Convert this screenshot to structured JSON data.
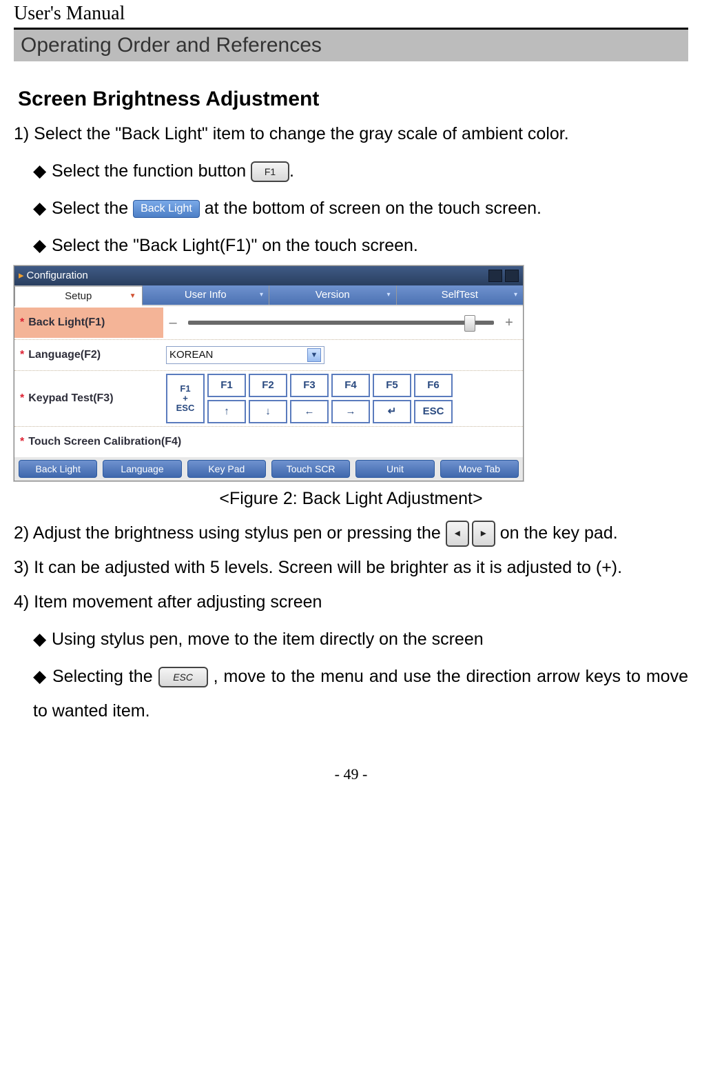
{
  "header": {
    "manual_title": "User's Manual",
    "section_bar": "Operating Order and References"
  },
  "subsection_title": "Screen Brightness Adjustment",
  "steps": {
    "s1": "1) Select the \"Back Light\" item to change the gray scale of ambient color.",
    "s1_b1_a": "Select the function button ",
    "s1_b1_icon": "F1",
    "s1_b1_b": ".",
    "s1_b2_a": "Select the ",
    "s1_b2_btn": "Back Light",
    "s1_b2_b": " at the bottom of screen on the touch screen.",
    "s1_b3": "Select the \"Back Light(F1)\" on the touch screen.",
    "s2_a": "2) Adjust the brightness using stylus pen or pressing the ",
    "s2_b": " on the key pad.",
    "s3": "3) It can be adjusted with 5 levels. Screen will be brighter as it is adjusted to (+).",
    "s4": "4) Item movement after adjusting screen",
    "s4_b1": "Using stylus pen, move to the item directly on the screen",
    "s4_b2_a": "Selecting the ",
    "s4_b2_icon": "ESC",
    "s4_b2_b": ", move to the menu and use the direction arrow keys to move to wanted item."
  },
  "figure": {
    "title": "Configuration",
    "tabs": [
      "Setup",
      "User Info",
      "Version",
      "SelfTest"
    ],
    "rows": {
      "r1": "Back Light(F1)",
      "r2": "Language(F2)",
      "r2_value": "KOREAN",
      "r3": "Keypad Test(F3)",
      "r4": "Touch Screen Calibration(F4)"
    },
    "keys_top": [
      "F1",
      "F2",
      "F3",
      "F4",
      "F5",
      "F6"
    ],
    "keys_bottom": [
      "↑",
      "↓",
      "←",
      "→",
      "↵",
      "ESC"
    ],
    "key_combo": "F1\n+\nESC",
    "bottom_buttons": [
      "Back Light",
      "Language",
      "Key Pad",
      "Touch SCR",
      "Unit",
      "Move Tab"
    ],
    "caption": "<Figure 2: Back Light Adjustment>"
  },
  "arrow_keys": {
    "left": "◂",
    "right": "▸"
  },
  "bullet": "◆",
  "page_number": "- 49 -"
}
